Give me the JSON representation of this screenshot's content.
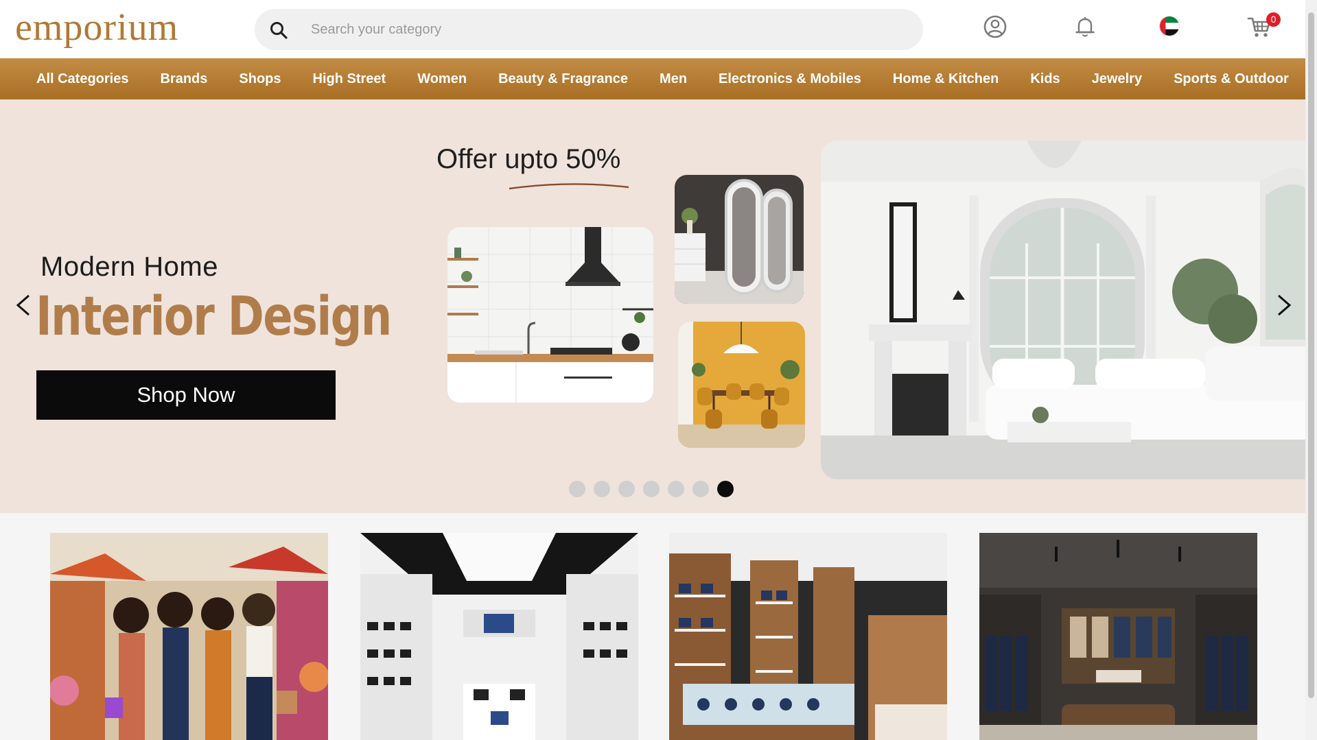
{
  "header": {
    "logo": "emporium",
    "search_placeholder": "Search your category",
    "cart_count": "0"
  },
  "nav": {
    "items": [
      "All Categories",
      "Brands",
      "Shops",
      "High Street",
      "Women",
      "Beauty & Fragrance",
      "Men",
      "Electronics & Mobiles",
      "Home & Kitchen",
      "Kids",
      "Jewelry",
      "Sports & Outdoor"
    ]
  },
  "hero": {
    "subtitle": "Modern Home",
    "title": "Interior Design",
    "cta": "Shop Now",
    "offer": "Offer upto 50%",
    "slide_count": 7,
    "active_slide": 7
  },
  "colors": {
    "brand": "#b07936",
    "nav_bg": "#b57b2f",
    "hero_bg": "#efe3dc",
    "badge": "#e11d2a"
  },
  "icons": {
    "search": "search-icon",
    "profile": "user-circle-icon",
    "notifications": "bell-icon",
    "country": "uae-flag-icon",
    "cart": "cart-icon",
    "prev": "chevron-left-icon",
    "next": "chevron-right-icon"
  }
}
